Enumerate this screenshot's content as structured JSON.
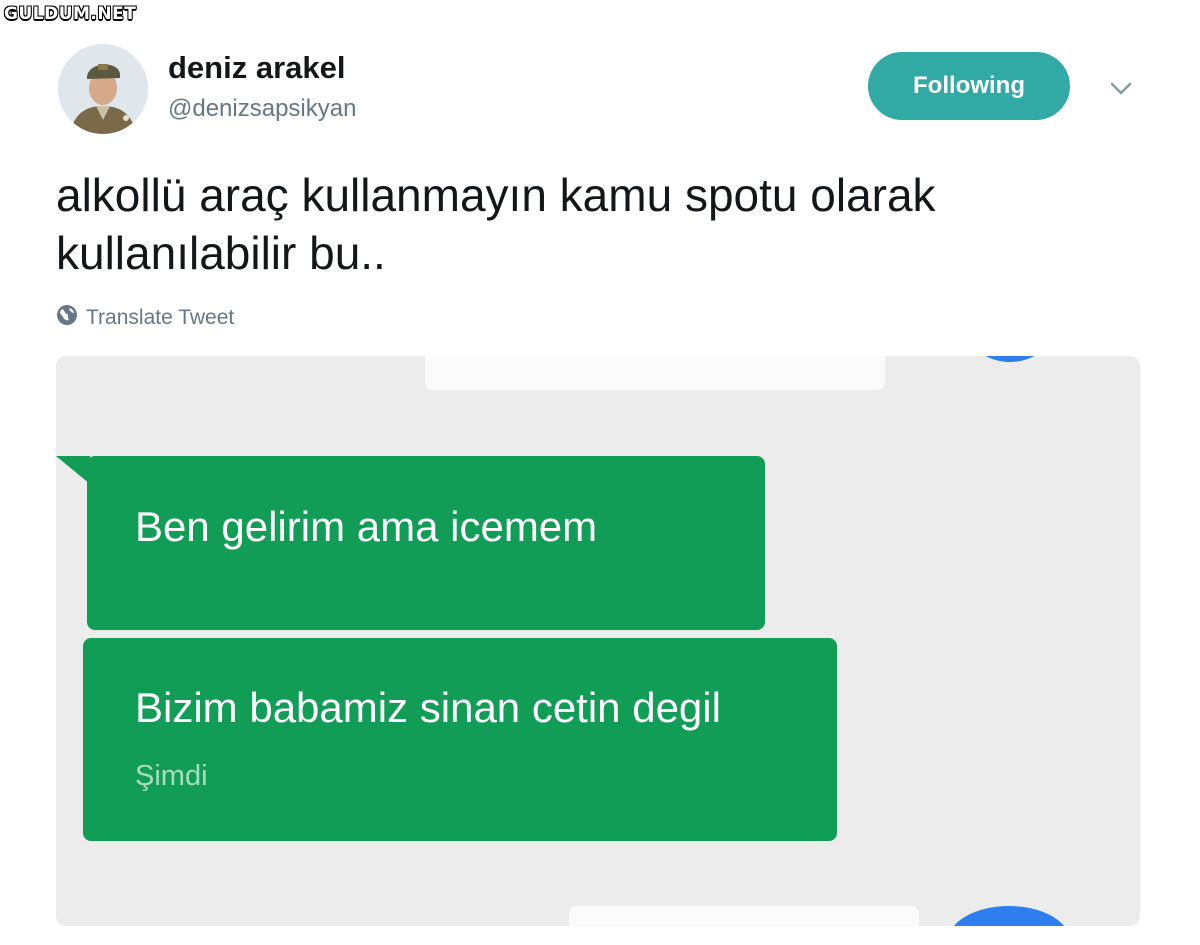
{
  "watermark": "GULDUM.NET",
  "tweet": {
    "author": {
      "display_name": "deniz arakel",
      "handle": "@denizsapsikyan"
    },
    "follow_button_label": "Following",
    "text": "alkollü araç kullanmayın kamu spotu olarak kullanılabilir bu..",
    "translate_label": "Translate Tweet"
  },
  "media": {
    "messages": [
      {
        "text": "Ben gelirim ama icemem"
      },
      {
        "text": "Bizim babamiz sinan cetin degil",
        "time": "Şimdi"
      }
    ]
  },
  "colors": {
    "accent": "#31aaa6",
    "bubble_green": "#129d56",
    "screenshot_bg": "#ececec",
    "blue_circle": "#2f7ef0"
  },
  "icons": [
    "globe-icon",
    "chevron-down-icon"
  ]
}
